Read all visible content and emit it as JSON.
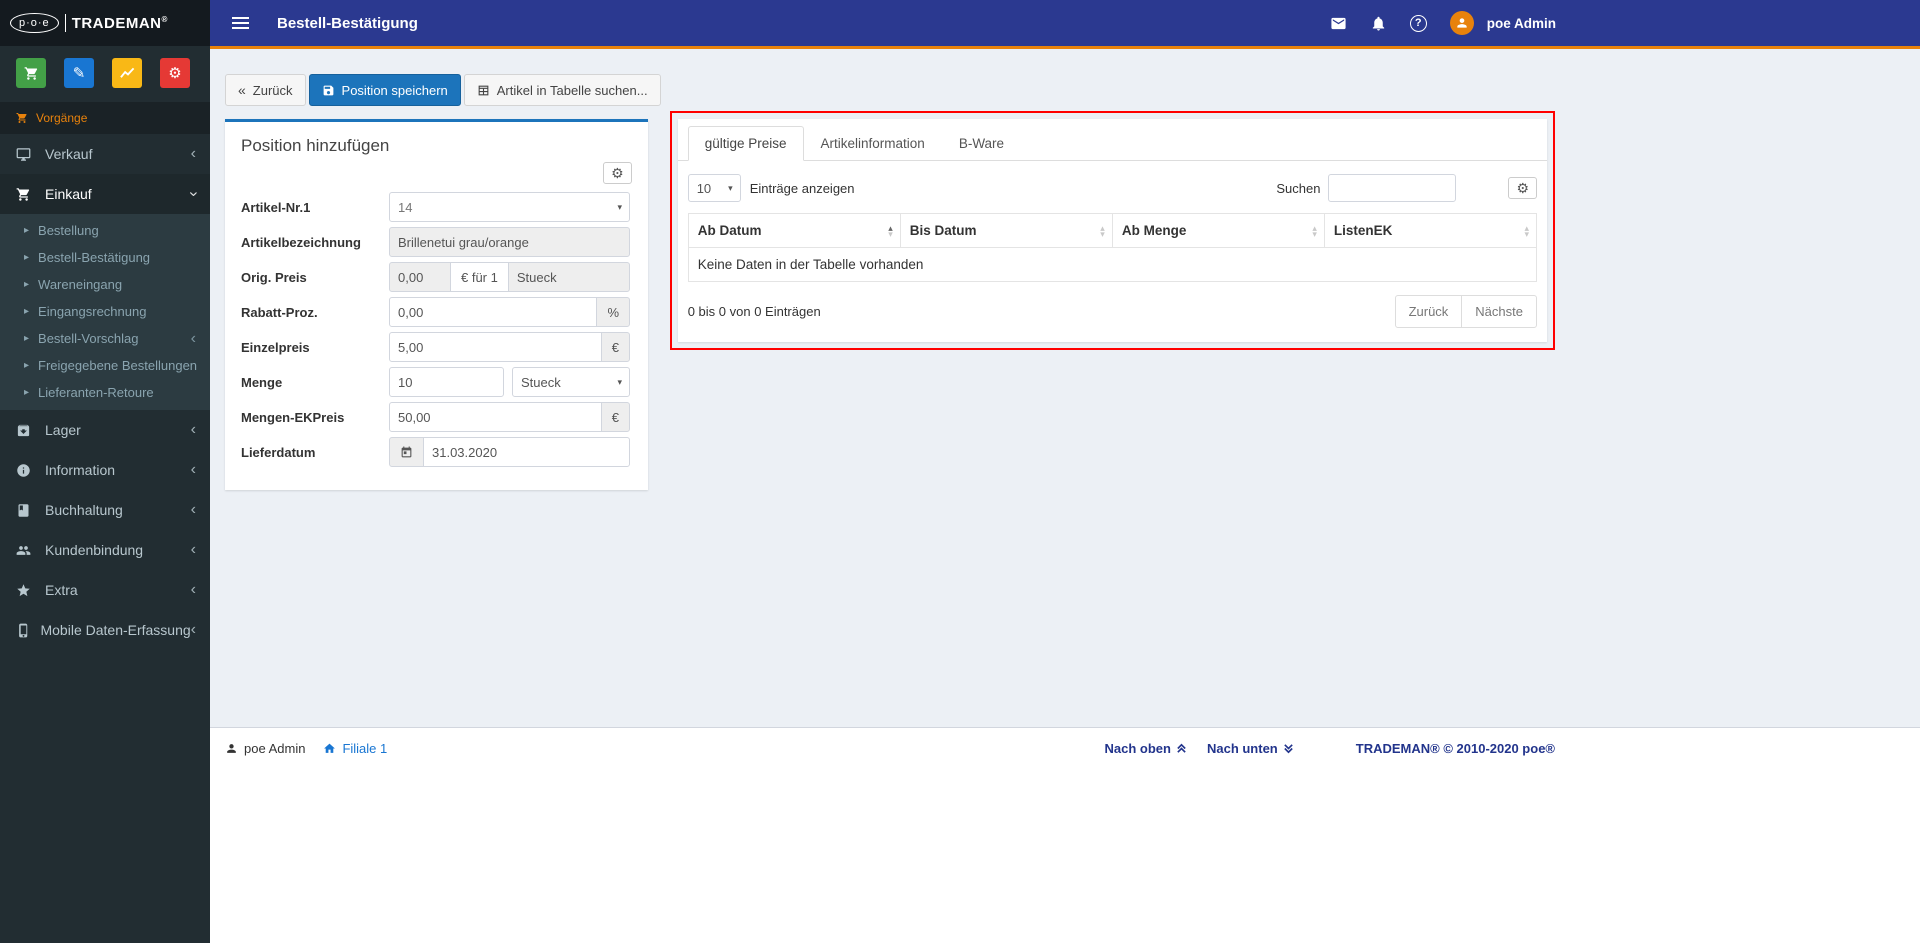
{
  "colors": {
    "header_bg": "#2b3990",
    "accent_orange": "#e8820c",
    "primary_blue": "#1c74bb",
    "sidebar_bg": "#222d32",
    "sidebar_dark": "#1a2226",
    "logo_bg": "#141a1f",
    "submenu_bg": "#2c3b41",
    "annotation_red": "#ff0000",
    "link_blue": "#1976d2",
    "footer_link_blue": "#22348c",
    "content_bg": "#ecf0f5",
    "quick_green": "#43a047",
    "quick_blue": "#1976d2",
    "quick_yellow": "#f9b816",
    "quick_red": "#e53935"
  },
  "brand": {
    "logo_prefix": "p·o·e",
    "logo_name": "TRADEMAN",
    "logo_reg": "®"
  },
  "header": {
    "title": "Bestell-Bestätigung",
    "user_name": "poe Admin"
  },
  "sidebar": {
    "section_label": "Vorgänge",
    "items": [
      {
        "label": "Verkauf"
      },
      {
        "label": "Einkauf"
      },
      {
        "label": "Lager"
      },
      {
        "label": "Information"
      },
      {
        "label": "Buchhaltung"
      },
      {
        "label": "Kundenbindung"
      },
      {
        "label": "Extra"
      },
      {
        "label": "Mobile Daten-Erfassung"
      }
    ],
    "einkauf_children": [
      {
        "label": "Bestellung"
      },
      {
        "label": "Bestell-Bestätigung"
      },
      {
        "label": "Wareneingang"
      },
      {
        "label": "Eingangsrechnung"
      },
      {
        "label": "Bestell-Vorschlag"
      },
      {
        "label": "Freigegebene Bestellungen"
      },
      {
        "label": "Lieferanten-Retoure"
      }
    ]
  },
  "toolbar": {
    "back_label": "Zurück",
    "save_label": "Position speichern",
    "search_table_label": "Artikel in Tabelle suchen..."
  },
  "form": {
    "title": "Position hinzufügen",
    "artikel_nr": {
      "label": "Artikel-Nr.1",
      "value": "14"
    },
    "artikelbezeichnung": {
      "label": "Artikelbezeichnung",
      "value": "Brillenetui grau/orange"
    },
    "orig_preis": {
      "label": "Orig. Preis",
      "value": "0,00",
      "addon": "€ für 1",
      "unit": "Stueck"
    },
    "rabatt_proz": {
      "label": "Rabatt-Proz.",
      "value": "0,00",
      "suffix": "%"
    },
    "einzelpreis": {
      "label": "Einzelpreis",
      "value": "5,00",
      "suffix": "€"
    },
    "menge": {
      "label": "Menge",
      "value": "10",
      "unit": "Stueck"
    },
    "mengen_ekpreis": {
      "label": "Mengen-EKPreis",
      "value": "50,00",
      "suffix": "€"
    },
    "lieferdatum": {
      "label": "Lieferdatum",
      "value": "31.03.2020"
    }
  },
  "price_panel": {
    "tabs": [
      {
        "label": "gültige Preise"
      },
      {
        "label": "Artikelinformation"
      },
      {
        "label": "B-Ware"
      }
    ],
    "length_value": "10",
    "length_label": "Einträge anzeigen",
    "search_label": "Suchen",
    "search_value": "",
    "table": {
      "columns": [
        "Ab Datum",
        "Bis Datum",
        "Ab Menge",
        "ListenEK"
      ],
      "empty_message": "Keine Daten in der Tabelle vorhanden",
      "info": "0 bis 0 von 0 Einträgen",
      "prev_label": "Zurück",
      "next_label": "Nächste"
    }
  },
  "footer": {
    "user": "poe Admin",
    "branch": "Filiale 1",
    "up_label": "Nach oben",
    "down_label": "Nach unten",
    "copyright": "TRADEMAN® © 2010-2020 poe®"
  },
  "icons": {
    "back_chevrons": "«",
    "pencil": "✎",
    "gears": "⚙",
    "question": "?",
    "chevron_collapsed": "‹",
    "submenu_caret": "▸",
    "sort_up": "▴",
    "sort_down": "▾",
    "select_caret": "▾"
  }
}
